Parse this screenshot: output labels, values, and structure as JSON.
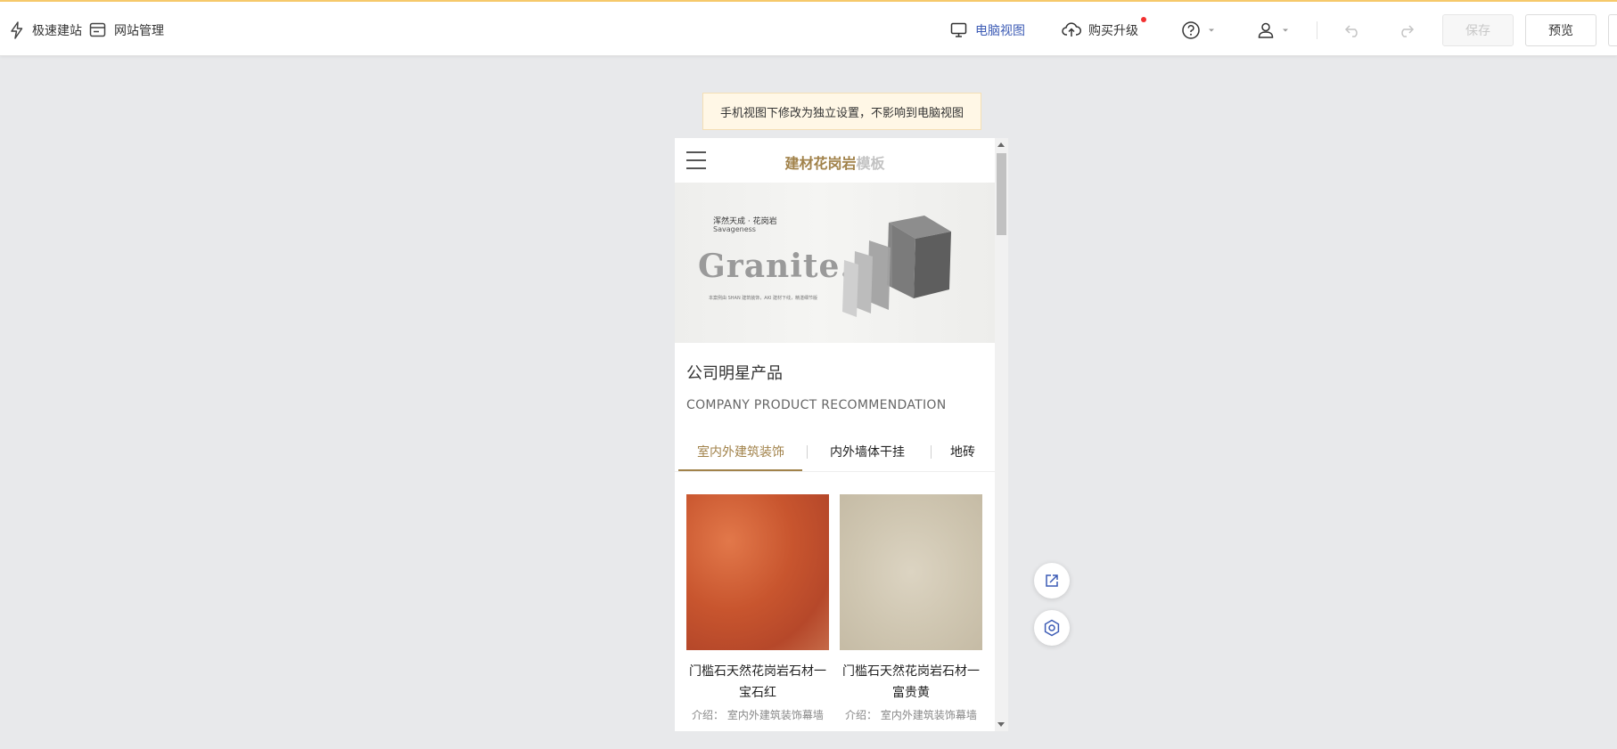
{
  "toolbar": {
    "quick_build": "极速建站",
    "site_manage": "网站管理",
    "desktop_view": "电脑视图",
    "upgrade": "购买升级",
    "save": "保存",
    "preview": "预览"
  },
  "notice": "手机视图下修改为独立设置，不影响到电脑视图",
  "site": {
    "title_main": "建材花岗岩",
    "title_sub": "模板"
  },
  "banner": {
    "line1": "浑然天成 · 花岗岩",
    "line2": "Savageness",
    "headline": "Granite.",
    "caption": "本案例由 SHAN 建筑装饰，AKI 建材下线，精湛细节版"
  },
  "section": {
    "title": "公司明星产品",
    "subtitle": "COMPANY PRODUCT RECOMMENDATION"
  },
  "tabs": [
    {
      "label": "室内外建筑装饰"
    },
    {
      "label": "内外墙体干挂"
    },
    {
      "label": "地砖"
    }
  ],
  "products": [
    {
      "name": "门槛石天然花岗岩石材一宝石红",
      "desc": "介绍：  室内外建筑装饰幕墙"
    },
    {
      "name": "门槛石天然花岗岩石材一富贵黄",
      "desc": "介绍：  室内外建筑装饰幕墙"
    }
  ],
  "colors": {
    "accent": "#a1824a",
    "active_view": "#3c5bb5",
    "notice_bg": "#fff7e6",
    "product1": "#c8552e",
    "product2": "#d4cbb7"
  },
  "icons": [
    "lightning-icon",
    "site-manage-icon",
    "monitor-icon",
    "cloud-upload-icon",
    "help-icon",
    "user-icon",
    "undo-icon",
    "redo-icon",
    "hamburger-icon",
    "share-icon",
    "settings-icon"
  ]
}
